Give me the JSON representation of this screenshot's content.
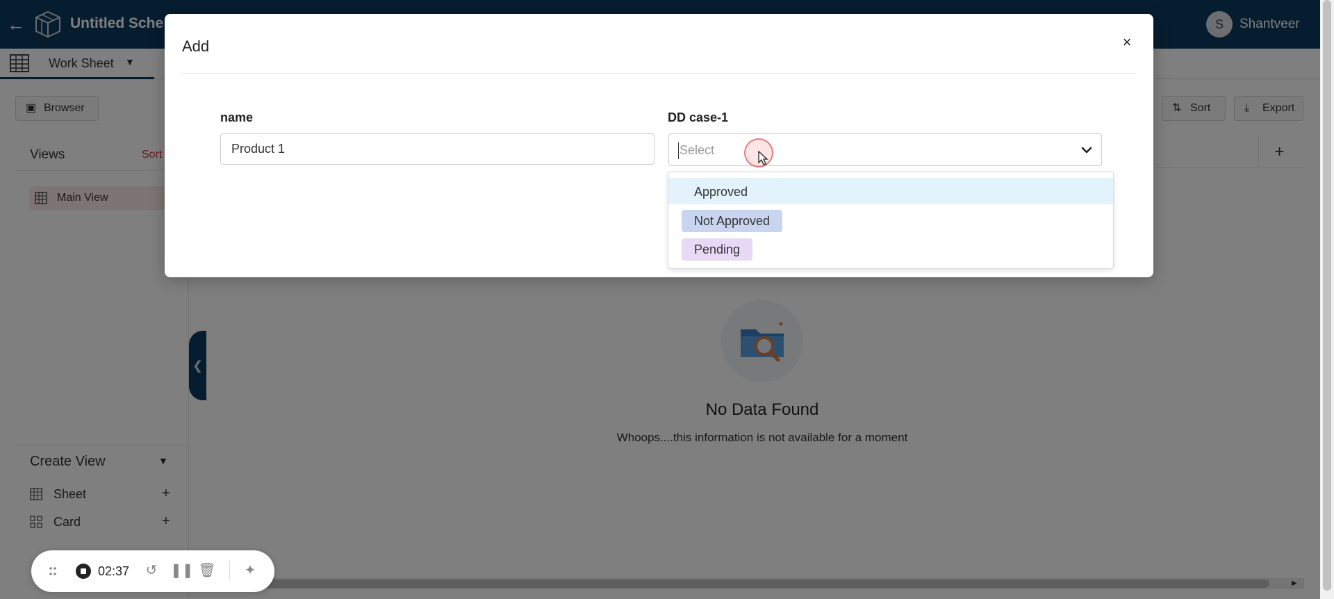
{
  "app": {
    "title": "Untitled Sche",
    "user_initial": "S",
    "user_name": "Shantveer"
  },
  "tabs": {
    "worksheet_label": "Work Sheet"
  },
  "toolbar": {
    "browser_label": "Browser",
    "sort_label": "Sort",
    "export_label": "Export"
  },
  "sidebar": {
    "views_title": "Views",
    "views_sort": "Sort",
    "view_items": [
      {
        "label": "Main View"
      }
    ],
    "create_view_title": "Create View",
    "create_items": [
      {
        "label": "Sheet",
        "add": "+"
      },
      {
        "label": "Card",
        "add": "+"
      }
    ]
  },
  "main": {
    "add_column": "+",
    "empty_title": "No Data Found",
    "empty_subtitle": "Whoops....this information is not available for a moment"
  },
  "modal": {
    "title": "Add",
    "close": "×",
    "fields": {
      "name_label": "name",
      "name_value": "Product 1",
      "dd_label": "DD case-1",
      "dd_placeholder": "Select"
    },
    "options": [
      {
        "label": "Approved",
        "color": "#e3f3fb"
      },
      {
        "label": "Not Approved",
        "color": "#c8d4f0"
      },
      {
        "label": "Pending",
        "color": "#e8d9f7"
      }
    ]
  },
  "recorder": {
    "time": "02:37"
  },
  "colors": {
    "brand": "#0d3b5e",
    "accent_red": "#dd3333"
  }
}
